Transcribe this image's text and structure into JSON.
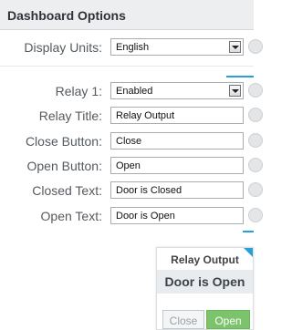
{
  "header": {
    "title": "Dashboard Options"
  },
  "fields": {
    "display_units": {
      "label": "Display Units:",
      "value": "English"
    },
    "relay": {
      "label": "Relay 1:",
      "value": "Enabled"
    },
    "relay_title": {
      "label": "Relay Title:",
      "value": "Relay Output"
    },
    "close_button": {
      "label": "Close Button:",
      "value": "Close"
    },
    "open_button": {
      "label": "Open Button:",
      "value": "Open"
    },
    "closed_text": {
      "label": "Closed Text:",
      "value": "Door is Closed"
    },
    "open_text": {
      "label": "Open Text:",
      "value": "Door is Open"
    }
  },
  "preview": {
    "title": "Relay Output",
    "status": "Door is Open",
    "close_label": "Close",
    "open_label": "Open"
  },
  "colors": {
    "accent": "#2a9fd6",
    "open_button": "#7cc46b"
  }
}
